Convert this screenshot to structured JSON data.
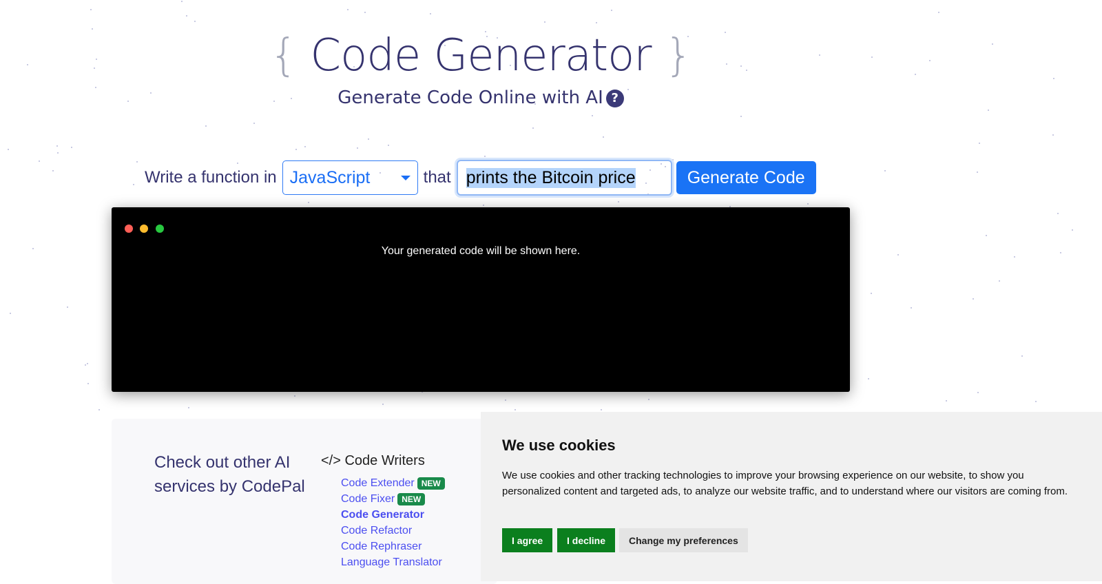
{
  "header": {
    "bracket_open": "{",
    "title": "Code Generator",
    "bracket_close": "}",
    "subtitle": "Generate Code Online with AI",
    "help_icon": "?"
  },
  "form": {
    "prefix": "Write a function in",
    "language": "JavaScript",
    "connector": "that",
    "prompt_value": "prints the Bitcoin price",
    "generate_label": "Generate Code"
  },
  "terminal": {
    "placeholder": "Your generated code will be shown here.",
    "dots": [
      "#ff5f57",
      "#febc2e",
      "#28c840"
    ]
  },
  "services": {
    "heading_line1": "Check out other AI",
    "heading_line2": "services by CodePal",
    "category_icon": "</>",
    "category": "Code Writers",
    "links": [
      {
        "label": "Code Extender",
        "badge": "NEW"
      },
      {
        "label": "Code Fixer",
        "badge": "NEW"
      },
      {
        "label": "Code Generator",
        "active": true
      },
      {
        "label": "Code Refactor"
      },
      {
        "label": "Code Rephraser"
      },
      {
        "label": "Language Translator"
      }
    ]
  },
  "cookies": {
    "title": "We use cookies",
    "text": "We use cookies and other tracking technologies to improve your browsing experience on our website, to show you personalized content and targeted ads, to analyze our website traffic, and to understand where our visitors are coming from.",
    "agree": "I agree",
    "decline": "I decline",
    "preferences": "Change my preferences"
  }
}
